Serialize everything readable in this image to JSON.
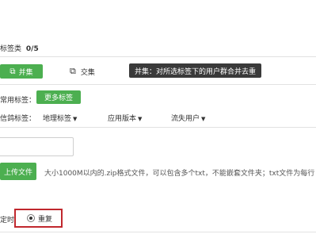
{
  "tag_count": {
    "label": "标签类",
    "value": "0/5"
  },
  "union_button": {
    "label": "并集",
    "icon": "union-icon"
  },
  "intersect_option": {
    "label": "交集",
    "icon": "intersect-icon"
  },
  "tooltip": {
    "text": "并集：对所选标签下的用户群合并去重"
  },
  "common_tags": {
    "label": "常用标签：",
    "more_button": "更多标签"
  },
  "info_tags": {
    "label": "信鸽标签：",
    "dropdowns": [
      "地理标签",
      "应用版本",
      "流失用户"
    ]
  },
  "upload": {
    "button": "上传文件",
    "hint": "大小1000M以内的.zip格式文件，可以包含多个txt，不能嵌套文件夹；txt文件为每行"
  },
  "timing": {
    "label": "定时",
    "selected_option": "重复"
  },
  "colors": {
    "accent_green": "#4caf50",
    "tooltip_bg": "#3a3a3a",
    "highlight_red": "#c0282e"
  }
}
